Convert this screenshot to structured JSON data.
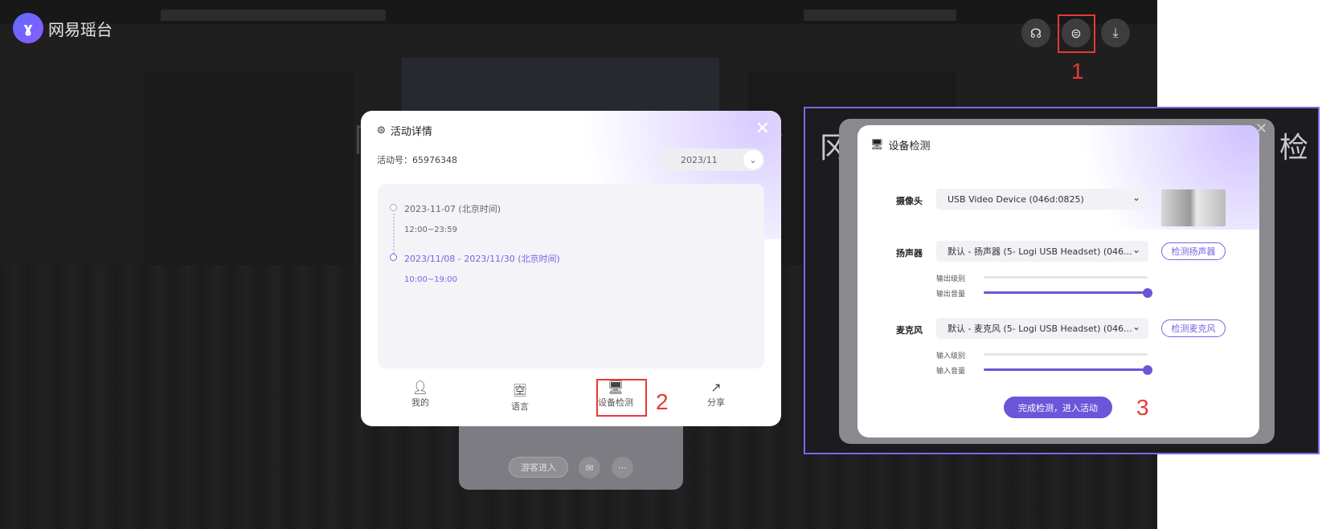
{
  "app": {
    "logo_text": "网易瑶台"
  },
  "background": {
    "ghost_chars": [
      "冈",
      "检",
      "冈",
      "检"
    ]
  },
  "annotations": {
    "step1": "1",
    "step2": "2",
    "step3": "3"
  },
  "lower_card": {
    "guest_label": "游客进入",
    "more_label": "···"
  },
  "activity_modal": {
    "title": "活动详情",
    "activity_no": "活动号：65976348",
    "month_select": "2023/11",
    "timeline": [
      {
        "date": "2023-11-07 (北京时间)",
        "time": "12:00~23:59"
      },
      {
        "date": "2023/11/08 - 2023/11/30 (北京时间)",
        "time": "10:00~19:00"
      }
    ],
    "actions": [
      {
        "label": "我的",
        "icon": "user-icon"
      },
      {
        "label": "语言",
        "icon": "language-icon"
      },
      {
        "label": "设备检测",
        "icon": "device-check-icon"
      },
      {
        "label": "分享",
        "icon": "share-icon"
      }
    ]
  },
  "device_check": {
    "title": "设备检测",
    "camera": {
      "label": "摄像头",
      "value": "USB Video Device (046d:0825)"
    },
    "speaker": {
      "label": "扬声器",
      "value": "默认 - 扬声器 (5- Logi USB Headset) (046...",
      "test_button": "检测扬声器",
      "output_level_label": "输出级别",
      "output_volume_label": "输出音量",
      "output_level": 0,
      "output_volume": 1.0
    },
    "microphone": {
      "label": "麦克风",
      "value": "默认 - 麦克风 (5- Logi USB Headset) (046...",
      "test_button": "检测麦克风",
      "input_level_label": "输入级别",
      "input_volume_label": "输入音量",
      "input_level": 0,
      "input_volume": 1.0
    },
    "finish_button": "完成检测，进入活动"
  },
  "colors": {
    "accent": "#6c55d8",
    "annotation_red": "#e53935"
  }
}
